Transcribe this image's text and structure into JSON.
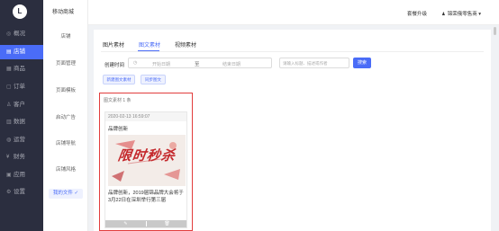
{
  "sidebar": {
    "logo": "L",
    "items": [
      {
        "icon": "dashboard-icon",
        "glyph": "◎",
        "label": "概况",
        "active": false
      },
      {
        "icon": "store-icon",
        "glyph": "▤",
        "label": "店铺",
        "active": true
      },
      {
        "icon": "goods-icon",
        "glyph": "▦",
        "label": "商品",
        "active": false
      },
      {
        "icon": "order-icon",
        "glyph": "▢",
        "label": "订单",
        "active": false
      },
      {
        "icon": "customer-icon",
        "glyph": "♙",
        "label": "客户",
        "active": false
      },
      {
        "icon": "data-icon",
        "glyph": "▥",
        "label": "数据",
        "active": false
      },
      {
        "icon": "operation-icon",
        "glyph": "◍",
        "label": "运营",
        "active": false
      },
      {
        "icon": "finance-icon",
        "glyph": "¥",
        "label": "财务",
        "active": false
      },
      {
        "icon": "app-icon",
        "glyph": "▣",
        "label": "应用",
        "active": false
      },
      {
        "icon": "settings-icon",
        "glyph": "⚙",
        "label": "设置",
        "active": false
      }
    ]
  },
  "submenu": {
    "title": "移动商城",
    "items": [
      {
        "label": "店铺",
        "active": false
      },
      {
        "label": "页面管理",
        "active": false
      },
      {
        "label": "页面模板",
        "active": false
      },
      {
        "label": "启动广告",
        "active": false
      },
      {
        "label": "店铺导航",
        "active": false
      },
      {
        "label": "店铺风格",
        "active": false
      },
      {
        "label": "我的文件 ✓",
        "active": true
      }
    ]
  },
  "header": {
    "upgrade": "套餐升级",
    "user": "锦荣俄零售商 ▾"
  },
  "tabs": [
    {
      "label": "图片素材",
      "active": false
    },
    {
      "label": "图文素材",
      "active": true
    },
    {
      "label": "视频素材",
      "active": false
    }
  ],
  "filter": {
    "created_label": "创建时间",
    "start_placeholder": "开始日期",
    "separator": "至",
    "end_placeholder": "结束日期",
    "search_placeholder": "请输入标题、描述或作者",
    "search_button": "搜索"
  },
  "actions": {
    "new_button": "新建图文素材",
    "sync_button": "同步图文"
  },
  "materials": {
    "count_label": "图文素材 1 条",
    "items": [
      {
        "time": "2020-02-13 16:59:07",
        "title": "品牌创新",
        "image_text": "限时秒杀",
        "description": "品牌创新，2019届锦品牌大会将于3月22日在深圳举行第三届",
        "edit_icon": "edit-icon",
        "delete_icon": "delete-icon"
      }
    ]
  },
  "colors": {
    "sidebar_bg": "#2b2e3f",
    "accent": "#4a6cf7",
    "highlight": "#e23d3d"
  }
}
